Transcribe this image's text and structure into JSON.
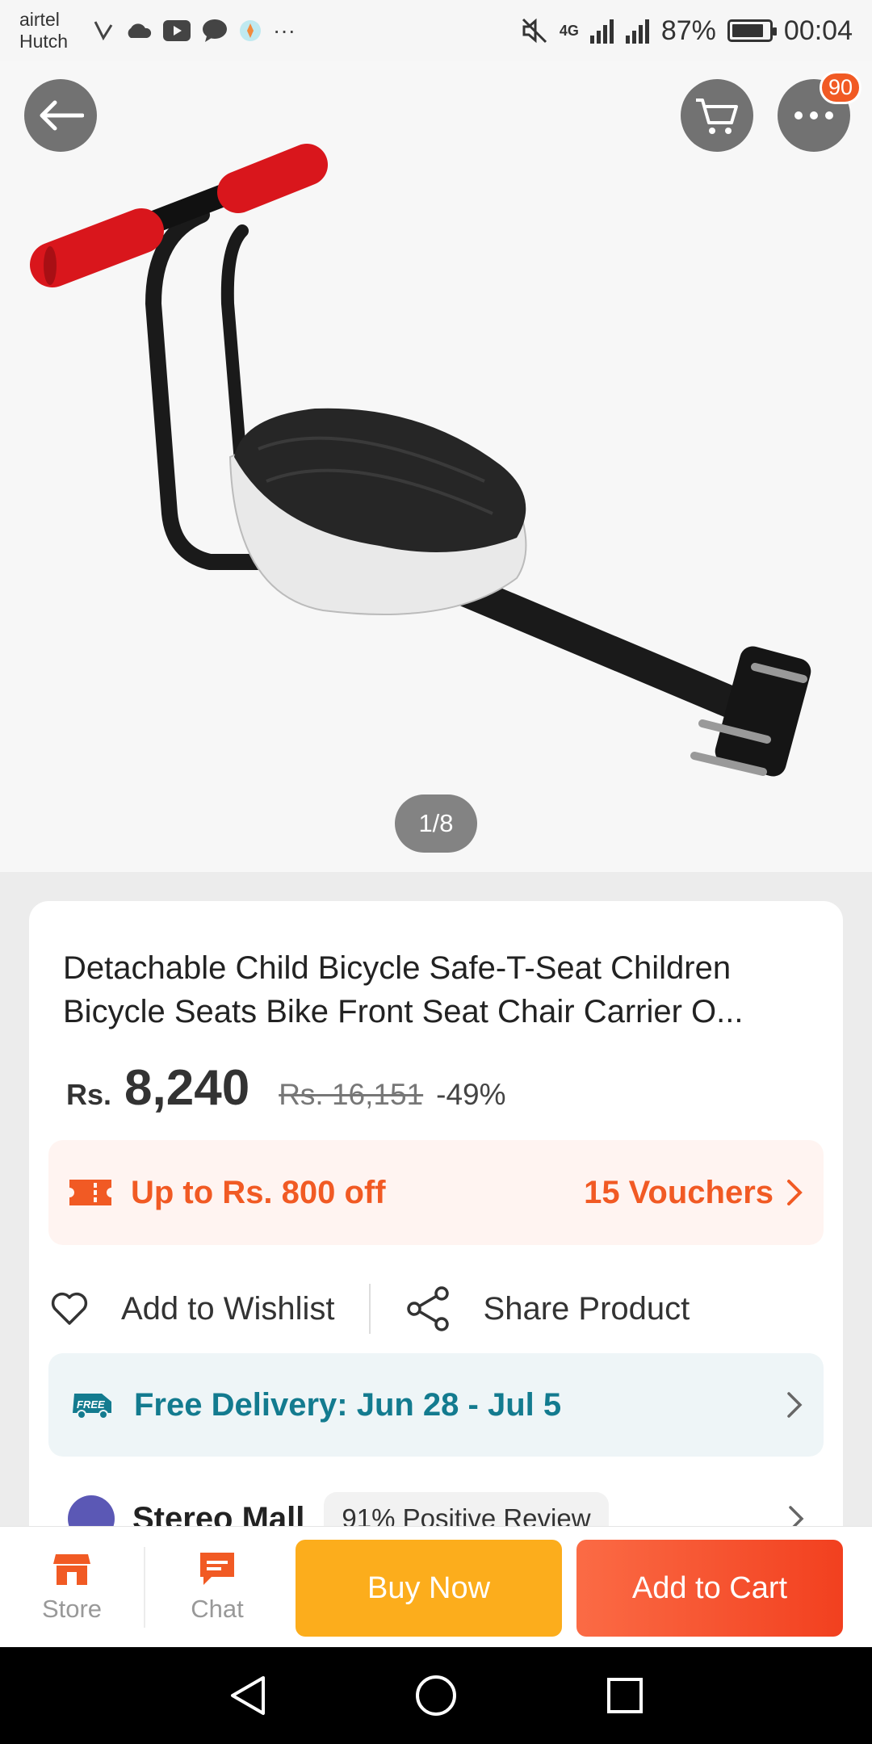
{
  "status_bar": {
    "carrier_1": "airtel",
    "carrier_2": "Hutch",
    "network": "4G",
    "battery": "87%",
    "time": "00:04",
    "battery_level": 0.87
  },
  "header": {
    "more_badge": "90"
  },
  "gallery": {
    "pager": "1/8"
  },
  "product": {
    "title": "Detachable Child Bicycle Safe-T-Seat Children Bicycle Seats Bike Front Seat Chair Carrier O...",
    "currency": "Rs.",
    "price": "8,240",
    "original_price": "Rs. 16,151",
    "discount": "-49%"
  },
  "voucher": {
    "text": "Up to Rs. 800 off",
    "count": "15 Vouchers"
  },
  "actions": {
    "wishlist": "Add to Wishlist",
    "share": "Share Product"
  },
  "delivery": {
    "badge": "FREE",
    "text": "Free Delivery: Jun 28 - Jul 5"
  },
  "store": {
    "name": "Stereo Mall",
    "review": "91% Positive Review"
  },
  "bottom_bar": {
    "store_label": "Store",
    "chat_label": "Chat",
    "buy_now": "Buy Now",
    "add_to_cart": "Add to Cart"
  },
  "colors": {
    "accent": "#f15a24",
    "delivery": "#137b8f",
    "buy_now": "#fcad1c",
    "add_to_cart": "#f2401f"
  }
}
